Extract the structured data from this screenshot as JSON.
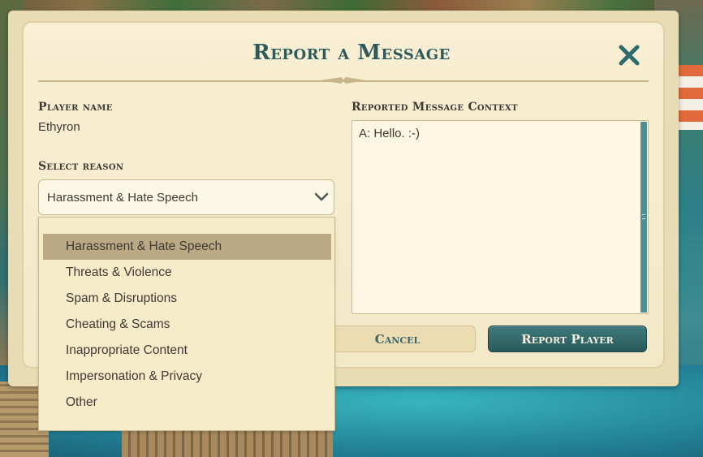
{
  "dialog": {
    "title": "Report a Message",
    "close_icon": "close-icon"
  },
  "player": {
    "label": "Player name",
    "name": "Ethyron"
  },
  "reason": {
    "label": "Select reason",
    "selected": "Harassment & Hate Speech",
    "options": [
      "Harassment & Hate Speech",
      "Threats & Violence",
      "Spam & Disruptions",
      "Cheating & Scams",
      "Inappropriate Content",
      "Impersonation & Privacy",
      "Other"
    ],
    "selected_index": 0
  },
  "context": {
    "label": "Reported Message Context",
    "text": "A: Hello. :-)"
  },
  "buttons": {
    "cancel": "Cancel",
    "report": "Report Player"
  },
  "colors": {
    "title": "#2f5a5c",
    "accent": "#2f6a6c",
    "panel": "#f6ecd0",
    "selected_option": "#bba986"
  }
}
